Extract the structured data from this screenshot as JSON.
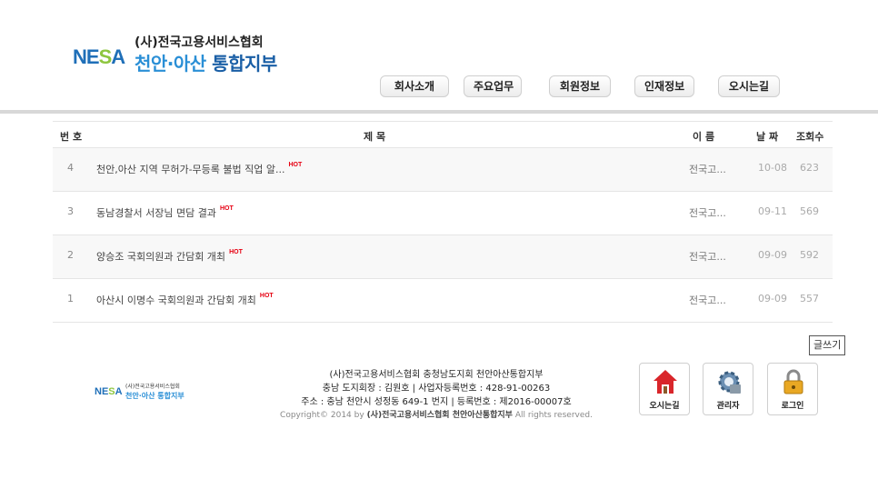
{
  "header": {
    "logo_text": "NESA",
    "org_name": "(사)전국고용서비스협회",
    "branch_name_1": "천안·아산",
    "branch_name_2": "통합지부"
  },
  "nav": [
    {
      "label": "회사소개"
    },
    {
      "label": "주요업무"
    },
    {
      "label": "회원정보"
    },
    {
      "label": "인재정보"
    },
    {
      "label": "오시는길"
    }
  ],
  "board": {
    "columns": {
      "num": "번 호",
      "title": "제 목",
      "name": "이 름",
      "date": "날 짜",
      "hits": "조회수"
    },
    "hot_label": "HOT",
    "rows": [
      {
        "num": "4",
        "title": "천안,아산 지역 무허가-무등록 불법 직업 알...",
        "name": "전국고...",
        "date": "10-08",
        "hits": "623"
      },
      {
        "num": "3",
        "title": "동남경찰서 서장님 면담 결과",
        "name": "전국고...",
        "date": "09-11",
        "hits": "569"
      },
      {
        "num": "2",
        "title": "양승조 국회의원과 간담회 개최",
        "name": "전국고...",
        "date": "09-09",
        "hits": "592"
      },
      {
        "num": "1",
        "title": "아산시 이명수 국회의원과 간담회 개최",
        "name": "전국고...",
        "date": "09-09",
        "hits": "557"
      }
    ],
    "write_label": "글쓰기"
  },
  "footer": {
    "logo_text": "NESA",
    "logo_org": "(사)전국고용서비스협회",
    "logo_branch": "천안·아산 통합지부",
    "line1": "(사)전국고용서비스협회 충청남도지회 천안아산통합지부",
    "line2": "충남 도지회장 : 김원호 | 사업자등록번호 : 428-91-00263",
    "line3": "주소 : 충남 천안시 성정동 649-1 번지 | 등록번호 : 제2016-00007호",
    "copy_prefix": "Copyright© 2014 by",
    "copy_org": "(사)전국고용서비스협회 천안아산통합지부",
    "copy_suffix": "All rights reserved.",
    "quick_buttons": [
      {
        "label": "오시는길",
        "icon": "house-icon"
      },
      {
        "label": "관리자",
        "icon": "gear-icon"
      },
      {
        "label": "로그인",
        "icon": "lock-icon"
      }
    ]
  }
}
